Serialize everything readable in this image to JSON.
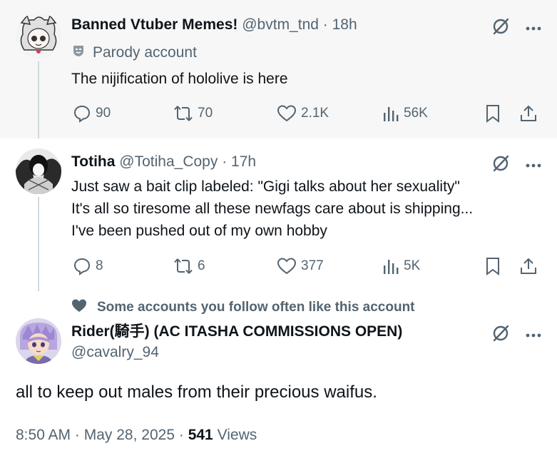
{
  "tweets": [
    {
      "name": "Banned Vtuber Memes!",
      "handle": "@bvtm_tnd",
      "separator": "·",
      "time": "18h",
      "parody_label": "Parody account",
      "text": "The nijification of hololive is here",
      "replies": "90",
      "retweets": "70",
      "likes": "2.1K",
      "views": "56K"
    },
    {
      "name": "Totiha",
      "handle": "@Totiha_Copy",
      "separator": "·",
      "time": "17h",
      "lines": [
        "Just saw a bait clip labeled: \"Gigi talks about her sexuality\"",
        "It's all so tiresome all these newfags care about is shipping...",
        "I've been pushed out of my own hobby"
      ],
      "replies": "8",
      "retweets": "6",
      "likes": "377",
      "views": "5K"
    }
  ],
  "main_tweet": {
    "social_context": "Some accounts you follow often like this account",
    "name": "Rider(騎手) (AC ITASHA COMMISSIONS OPEN)",
    "handle": "@cavalry_94",
    "text": "all to keep out males from their precious waifus.",
    "time": "8:50 AM",
    "separator1": "·",
    "date": "May 28, 2025",
    "separator2": "·",
    "views_count": "541",
    "views_label": "Views"
  },
  "icons": [
    "grok-icon",
    "more-icon",
    "reply-icon",
    "retweet-icon",
    "like-icon",
    "views-icon",
    "bookmark-icon",
    "share-icon",
    "heart-icon",
    "parody-mask-icon"
  ],
  "colors": {
    "text": "#0f1419",
    "secondary": "#536471",
    "highlight_bg": "#f7f7f7",
    "thread_line": "#cfd9de"
  }
}
